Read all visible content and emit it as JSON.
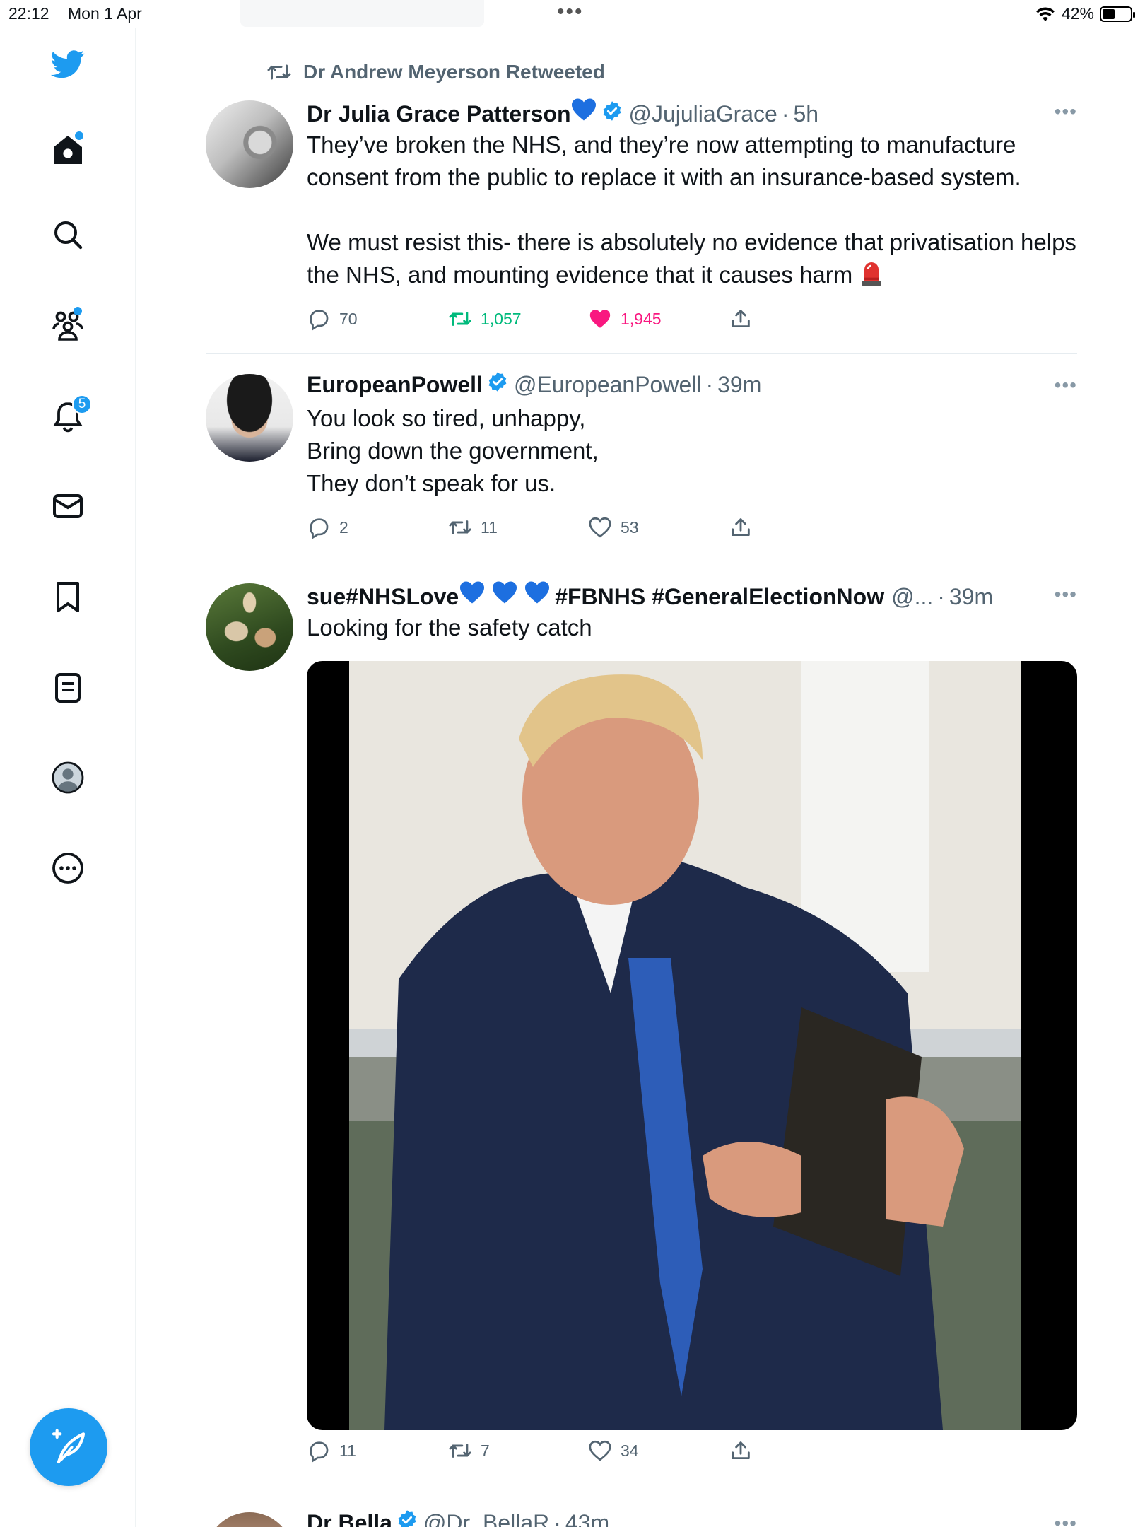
{
  "status_bar": {
    "time": "22:12",
    "date": "Mon 1 Apr",
    "battery": "42%",
    "dots": "•••"
  },
  "sidebar": {
    "icons": [
      "twitter-logo",
      "home-icon",
      "search-icon",
      "communities-icon",
      "notifications-icon",
      "messages-icon",
      "bookmarks-icon",
      "lists-icon",
      "profile-icon",
      "more-icon"
    ],
    "notifications_badge": "5",
    "accent": "#1d9bf0"
  },
  "tweets": [
    {
      "retweeted_by": "Dr Andrew Meyerson Retweeted",
      "name": "Dr Julia Grace Patterson",
      "handle": "@JujuliaGrace",
      "time": "5h",
      "text": "They’ve broken the NHS, and they’re now attempting to manufacture consent from the public to replace it with an insurance-based system.\n\nWe must resist this- there is absolutely no evidence that privatisation helps the NHS, and mounting evidence that it causes harm",
      "replies": "70",
      "retweets": "1,057",
      "likes": "1,945"
    },
    {
      "name": "EuropeanPowell",
      "handle": "@EuropeanPowell",
      "time": "39m",
      "text": "You look so tired, unhappy,\nBring down the government,\nThey don’t speak for us.",
      "replies": "2",
      "retweets": "11",
      "likes": "53"
    },
    {
      "name": "sue#NHSLove",
      "name_suffix": "#FBNHS #GeneralElectionNow",
      "handle": "@...",
      "time": "39m",
      "text": "Looking for the safety catch",
      "replies": "11",
      "retweets": "7",
      "likes": "34"
    },
    {
      "name": "Dr Bella",
      "handle": "@Dr_BellaR",
      "time": "43m"
    }
  ],
  "colors": {
    "retweet_green": "#00ba7c",
    "like_pink": "#f91880",
    "muted": "#536471"
  }
}
